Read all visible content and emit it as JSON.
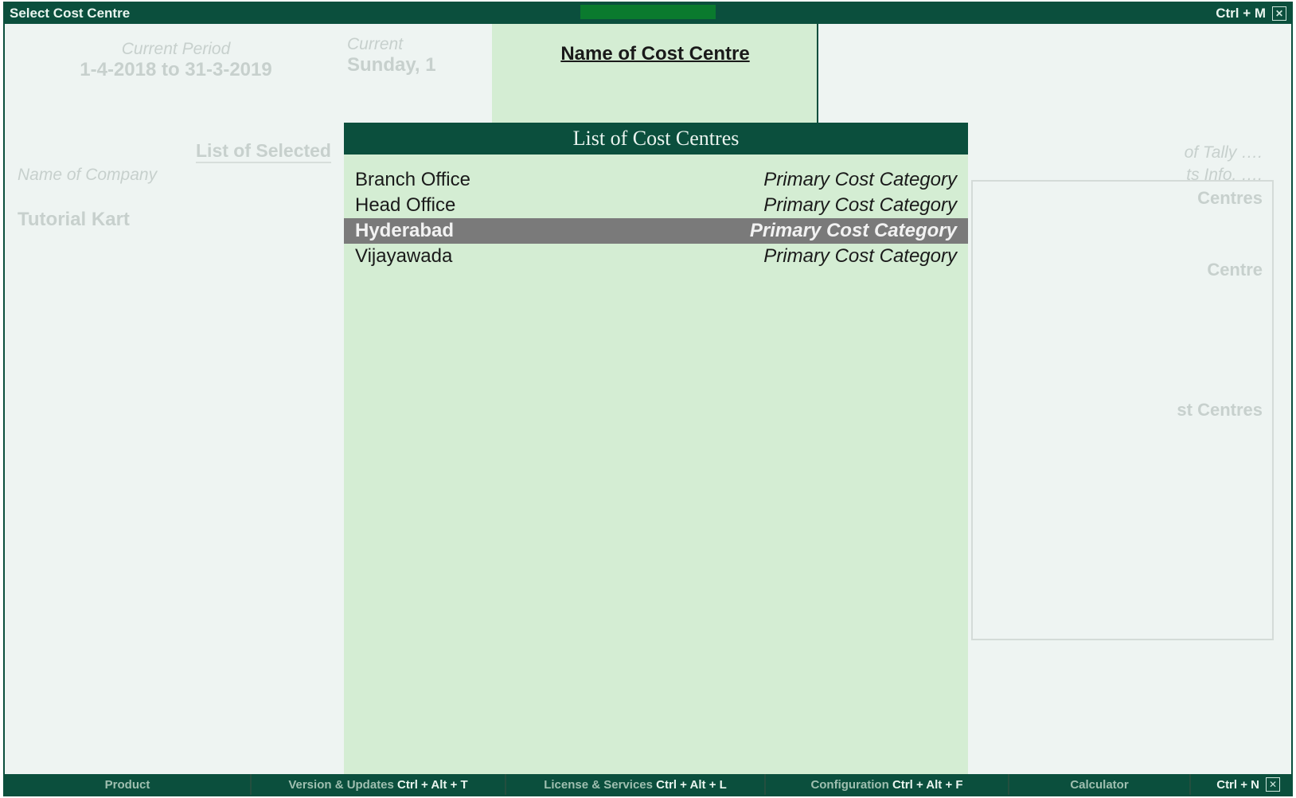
{
  "titlebar": {
    "title": "Select Cost Centre",
    "shortcut": "Ctrl + M"
  },
  "background": {
    "current_period_label": "Current Period",
    "current_period_value": "1-4-2018 to 31-3-2019",
    "current_date_label": "Current",
    "current_date_value": "Sunday, 1",
    "list_heading": "List of Selected",
    "name_of_company_label": "Name of Company",
    "company_name": "Tutorial Kart",
    "right_line1": "of Tally ….",
    "right_line2": "ts Info. ….",
    "right_line3": "Centres",
    "right_line4": "Centre",
    "right_line5": "st Centres"
  },
  "popup": {
    "header_title": "Name of Cost Centre",
    "list_title": "List of Cost Centres",
    "items": [
      {
        "name": "Branch Office",
        "category": "Primary Cost Category",
        "selected": false
      },
      {
        "name": "Head Office",
        "category": "Primary Cost Category",
        "selected": false
      },
      {
        "name": "Hyderabad",
        "category": "Primary Cost Category",
        "selected": true
      },
      {
        "name": "Vijayawada",
        "category": "Primary Cost Category",
        "selected": false
      }
    ]
  },
  "bottombar": {
    "product": "Product",
    "version_label": "Version & Updates",
    "version_shortcut": "Ctrl + Alt + T",
    "license_label": "License & Services",
    "license_shortcut": "Ctrl + Alt + L",
    "config_label": "Configuration",
    "config_shortcut": "Ctrl + Alt + F",
    "calculator": "Calculator",
    "ctrl_n": "Ctrl + N"
  }
}
